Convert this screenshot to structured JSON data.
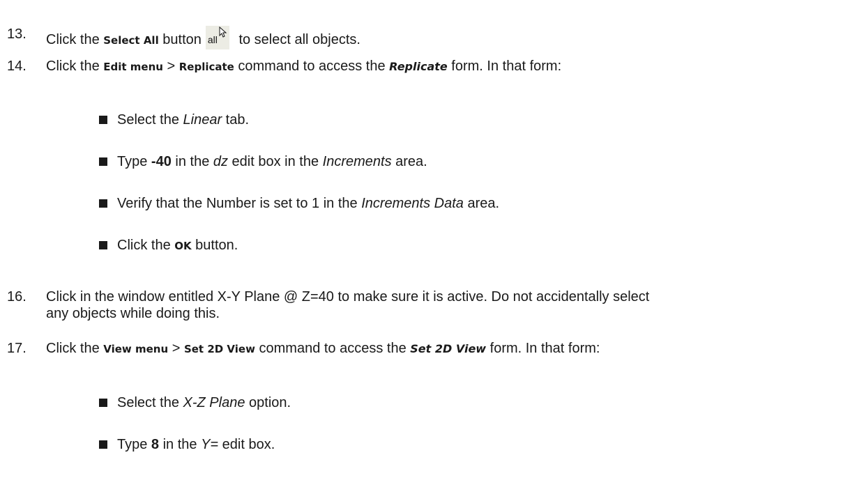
{
  "steps": [
    {
      "number": "13.",
      "parts": [
        "Click the ",
        "Select All",
        " button",
        " to select all objects."
      ]
    },
    {
      "number": "14.",
      "parts": [
        "Click the ",
        "Edit menu",
        " > ",
        "Replicate",
        " command to access the ",
        "Replicate",
        " form. In that form:"
      ]
    },
    {
      "number": "16.",
      "line1": "Click in the window entitled X-Y Plane @ Z=40 to make sure it is active.  Do not accidentally select",
      "line2": "any objects while doing this."
    },
    {
      "number": "17.",
      "parts": [
        "Click the ",
        "View menu",
        " > ",
        "Set 2D View",
        " command to access the ",
        "Set 2D View",
        " form. In that form:"
      ]
    }
  ],
  "step14_bullets": [
    {
      "parts": [
        "Select the ",
        "Linear",
        " tab."
      ]
    },
    {
      "parts": [
        "Type ",
        "-40",
        " in the ",
        "dz",
        " edit box in the ",
        "Increments",
        " area."
      ]
    },
    {
      "parts": [
        "Verify that the Number is set to 1 in the ",
        "Increments Data",
        " area."
      ]
    },
    {
      "parts": [
        "Click the ",
        "OK",
        " button."
      ]
    }
  ],
  "step17_bullets": [
    {
      "parts": [
        "Select the ",
        "X-Z Plane",
        " option."
      ]
    },
    {
      "parts": [
        "Type ",
        "8",
        " in the ",
        "Y=",
        " edit box."
      ]
    }
  ],
  "select_all_icon": {
    "label": "all",
    "name": "select-all-icon"
  }
}
